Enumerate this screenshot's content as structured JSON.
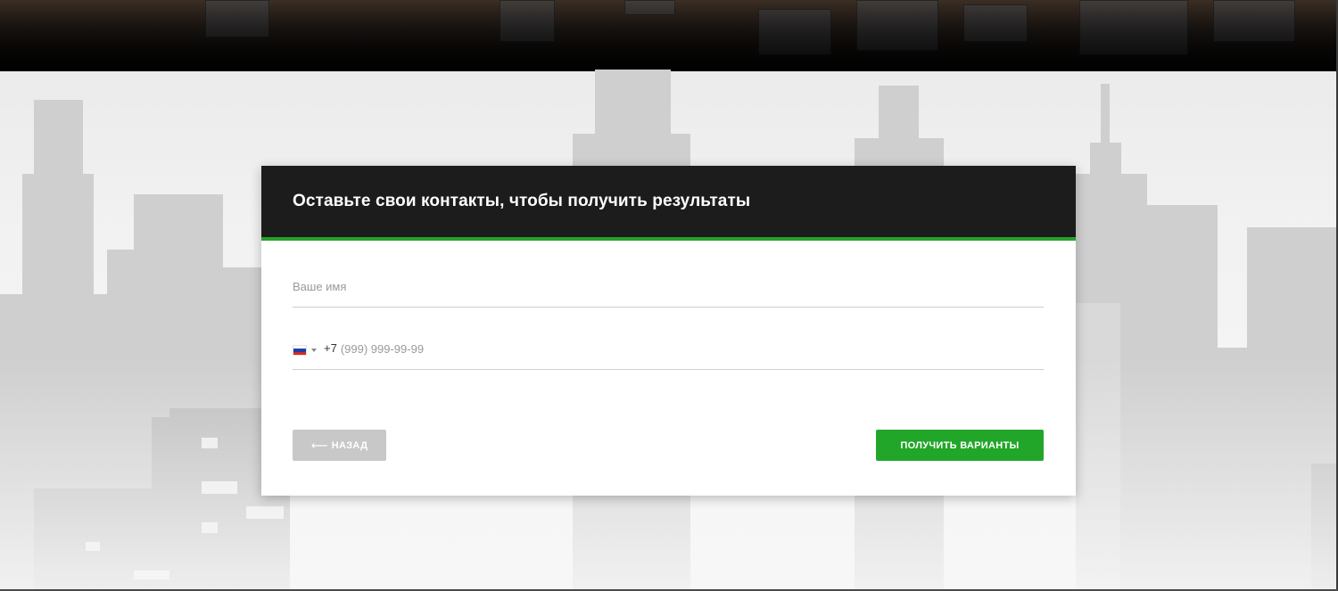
{
  "form": {
    "title": "Оставьте свои контакты, чтобы получить результаты",
    "name_placeholder": "Ваше имя",
    "phone_country_icon": "russia-flag-icon",
    "phone_code": "+7",
    "phone_placeholder": "(999) 999-99-99",
    "back_arrow": "⟵",
    "back_label": "НАЗАД",
    "submit_label": "ПОЛУЧИТЬ ВАРИАНТЫ"
  },
  "colors": {
    "header_bg": "#1c1c1c",
    "accent_green": "#27a22c",
    "submit_bg": "#22a62a",
    "back_bg": "#c8c8c8"
  }
}
